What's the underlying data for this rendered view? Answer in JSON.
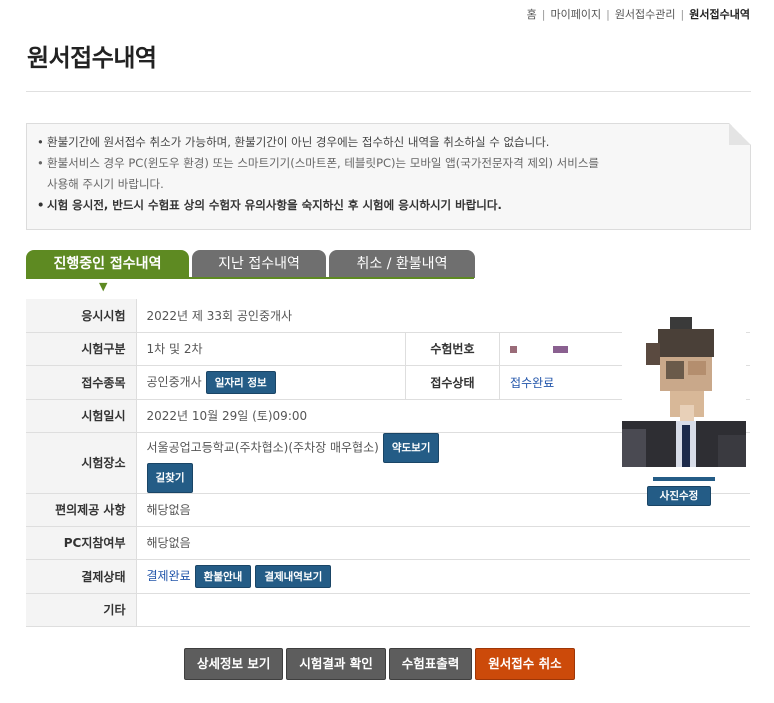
{
  "breadcrumb": {
    "items": [
      "홈",
      "마이페이지",
      "원서접수관리",
      "원서접수내역"
    ]
  },
  "page": {
    "title": "원서접수내역"
  },
  "notice": {
    "line1": "환불기간에 원서접수 취소가 가능하며, 환불기간이 아닌 경우에는 접수하신 내역을 취소하실 수 없습니다.",
    "line2a": "환불서비스 경우 PC(윈도우 환경) 또는 스마트기기(스마트폰, 테블릿PC)는 모바일 앱(국가전문자격 제외) 서비스를",
    "line2b": "사용해 주시기 바랍니다.",
    "line3": "시험 응시전, 반드시 수험표 상의 수험자 유의사항을 숙지하신 후 시험에 응시하시기 바랍니다."
  },
  "tabs": {
    "active": "진행중인 접수내역",
    "past": "지난 접수내역",
    "cancel": "취소 / 환불내역"
  },
  "info": {
    "exam_label": "응시시험",
    "exam_value": "2022년 제 33회 공인중개사",
    "type_label": "시험구분",
    "type_value": "1차 및 2차",
    "number_label": "수험번호",
    "category_label": "접수종목",
    "category_value": "공인중개사",
    "job_button": "일자리 정보",
    "status_label": "접수상태",
    "status_value": "접수완료",
    "date_label": "시험일시",
    "date_value": "2022년 10월 29일 (토)09:00",
    "place_label": "시험장소",
    "place_value": "서울공업고등학교(주차협소)(주차장 매우협소)",
    "map_button": "약도보기",
    "route_button": "길찾기",
    "convenience_label": "편의제공 사항",
    "convenience_value": "해당없음",
    "pc_label": "PC지참여부",
    "pc_value": "해당없음",
    "payment_label": "결제상태",
    "payment_value": "결제완료",
    "refund_button": "환불안내",
    "payment_history_button": "결제내역보기",
    "etc_label": "기타",
    "etc_value": ""
  },
  "photo": {
    "edit_button": "사진수정"
  },
  "actions": {
    "detail": "상세정보 보기",
    "result": "시험결과 확인",
    "ticket": "수험표출력",
    "cancel": "원서접수 취소"
  },
  "colors": {
    "accent_green": "#5e8a22",
    "button_blue": "#245c86",
    "cancel_orange": "#cc4a0a",
    "tab_gray": "#6f6f6f"
  }
}
